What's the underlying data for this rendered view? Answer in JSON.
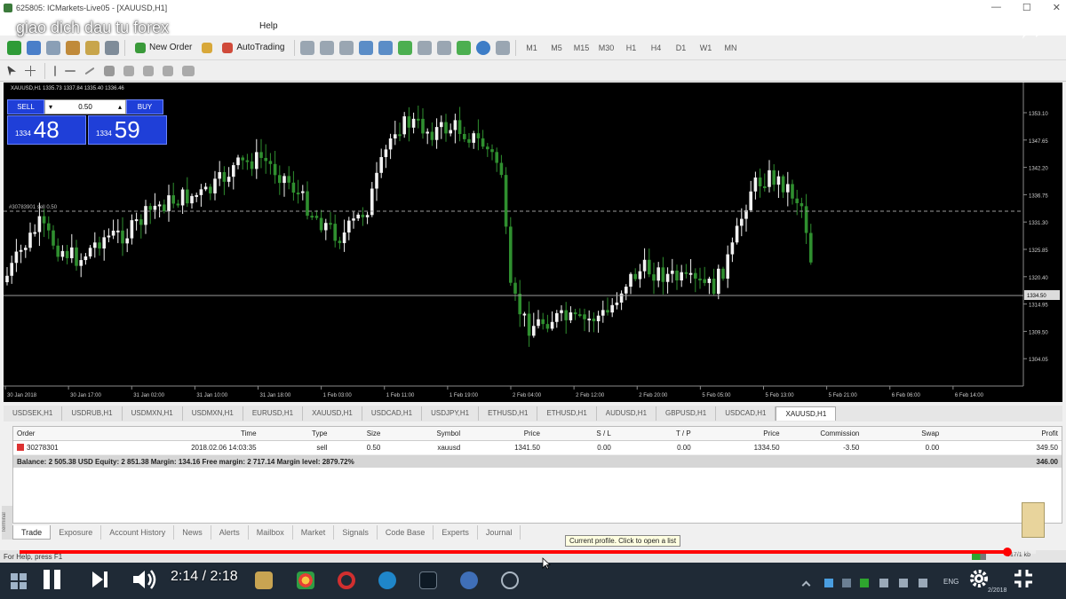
{
  "window": {
    "title": "625805: ICMarkets-Live05 - [XAUUSD,H1]",
    "controls": [
      "—",
      "☐",
      "✕"
    ]
  },
  "menu": {
    "items": [
      "Help"
    ]
  },
  "video_overlay": {
    "title": "giao dich dau tu forex",
    "elapsed": "2:14",
    "separator": " / ",
    "duration": "2:18",
    "progress_fraction": 0.972
  },
  "toolbar": {
    "new_order_label": "New Order",
    "autotrading_label": "AutoTrading",
    "timeframes": [
      "M1",
      "M5",
      "M15",
      "M30",
      "H1",
      "H4",
      "D1",
      "W1",
      "MN"
    ]
  },
  "chart": {
    "header_text": "XAUUSD,H1  1335.73 1337.84 1335.40 1336.46",
    "symbol": "XAUUSD",
    "timeframe": "H1",
    "current_price": "1334.50",
    "open_line_label": "#30783901 sell 0.50",
    "price_ticks": [
      "1353.10",
      "1347.65",
      "1342.20",
      "1336.75",
      "1331.30",
      "1325.85",
      "1320.40",
      "1314.95",
      "1309.50",
      "1304.05"
    ],
    "time_ticks": [
      "30 Jan 2018",
      "30 Jan 17:00",
      "31 Jan 02:00",
      "31 Jan 10:00",
      "31 Jan 18:00",
      "1 Feb 03:00",
      "1 Feb 11:00",
      "1 Feb 19:00",
      "2 Feb 04:00",
      "2 Feb 12:00",
      "2 Feb 20:00",
      "5 Feb 05:00",
      "5 Feb 13:00",
      "5 Feb 21:00",
      "6 Feb 06:00",
      "6 Feb 14:00"
    ],
    "colors": {
      "bull": "#f2f2f2",
      "bear": "#2f8f2f",
      "grid": "#5a5a5a",
      "level": "#9a9a9a",
      "background": "#000000"
    }
  },
  "trade_panel": {
    "sell_label": "SELL",
    "buy_label": "BUY",
    "lot": "0.50",
    "lot_down": "▾",
    "lot_up": "▴",
    "sell_prefix": "1334",
    "sell_big": "48",
    "buy_prefix": "1334",
    "buy_big": "59"
  },
  "symbol_tabs": [
    "USDSEK,H1",
    "USDRUB,H1",
    "USDMXN,H1",
    "USDMXN,H1",
    "EURUSD,H1",
    "XAUUSD,H1",
    "USDCAD,H1",
    "USDJPY,H1",
    "ETHUSD,H1",
    "ETHUSD,H1",
    "AUDUSD,H1",
    "GBPUSD,H1",
    "USDCAD,H1",
    "XAUUSD,H1"
  ],
  "terminal": {
    "columns": [
      "Order",
      "Time",
      "Type",
      "Size",
      "Symbol",
      "Price",
      "S / L",
      "T / P",
      "Price",
      "Commission",
      "Swap",
      "Profit"
    ],
    "rows": [
      {
        "order": "30278301",
        "time": "2018.02.06 14:03:35",
        "type": "sell",
        "size": "0.50",
        "symbol": "xauusd",
        "price": "1341.50",
        "sl": "0.00",
        "tp": "0.00",
        "price2": "1334.50",
        "commission": "-3.50",
        "swap": "0.00",
        "profit": "349.50"
      }
    ],
    "balance_text": "Balance: 2 505.38 USD  Equity: 2 851.38  Margin: 134.16  Free margin: 2 717.14  Margin level: 2879.72%",
    "balance_profit": "346.00",
    "side_label": "Terminal",
    "tabs": [
      "Trade",
      "Exposure",
      "Account History",
      "News",
      "Alerts",
      "Mailbox",
      "Market",
      "Signals",
      "Code Base",
      "Experts",
      "Journal"
    ],
    "tooltip": "Current profile. Click to open a list"
  },
  "status": {
    "help": "For Help, press F1",
    "right": "817/1 kb"
  },
  "taskbar": {
    "lang": "ENG",
    "clock": "2/2018"
  }
}
